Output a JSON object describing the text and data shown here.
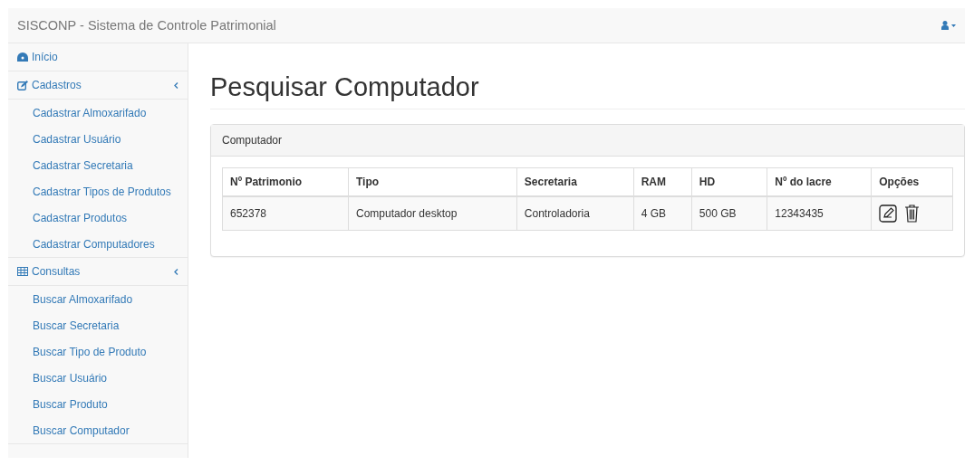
{
  "navbar": {
    "brand": "SISCONP - Sistema de Controle Patrimonial"
  },
  "sidebar": {
    "items": [
      {
        "label": "Início"
      },
      {
        "label": "Cadastros",
        "expanded": true,
        "children": [
          {
            "label": "Cadastrar Almoxarifado"
          },
          {
            "label": "Cadastrar Usuário"
          },
          {
            "label": "Cadastrar Secretaria"
          },
          {
            "label": "Cadastrar Tipos de Produtos"
          },
          {
            "label": "Cadastrar Produtos"
          },
          {
            "label": "Cadastrar Computadores"
          }
        ]
      },
      {
        "label": "Consultas",
        "expanded": true,
        "children": [
          {
            "label": "Buscar Almoxarifado"
          },
          {
            "label": "Buscar Secretaria"
          },
          {
            "label": "Buscar Tipo de Produto"
          },
          {
            "label": "Buscar Usuário"
          },
          {
            "label": "Buscar Produto"
          },
          {
            "label": "Buscar Computador"
          }
        ]
      }
    ]
  },
  "page": {
    "title": "Pesquisar Computador"
  },
  "panel": {
    "heading": "Computador",
    "table": {
      "columns": [
        "Nº Patrimonio",
        "Tipo",
        "Secretaria",
        "RAM",
        "HD",
        "Nº do lacre",
        "Opções"
      ],
      "rows": [
        {
          "cells": [
            "652378",
            "Computador desktop",
            "Controladoria",
            "4 GB",
            "500 GB",
            "12343435"
          ]
        }
      ]
    }
  }
}
